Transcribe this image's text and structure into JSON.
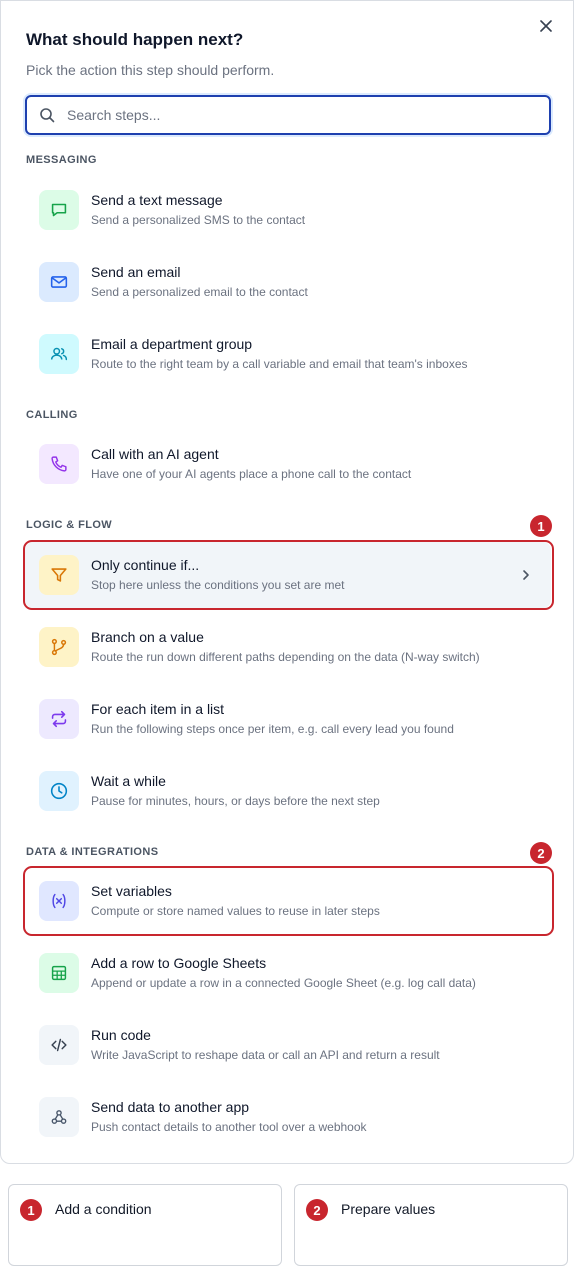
{
  "dialog": {
    "title": "What should happen next?",
    "subtitle": "Pick the action this step should perform.",
    "search_placeholder": "Search steps..."
  },
  "sections": [
    {
      "label": "MESSAGING",
      "items": [
        {
          "name": "Send a text message",
          "desc": "Send a personalized SMS to the contact",
          "icon": "message-icon",
          "color": "#16a34a",
          "bg": "#dcfce7"
        },
        {
          "name": "Send an email",
          "desc": "Send a personalized email to the contact",
          "icon": "mail-icon",
          "color": "#2563eb",
          "bg": "#dbeafe"
        },
        {
          "name": "Email a department group",
          "desc": "Route to the right team by a call variable and email that team's inboxes",
          "icon": "users-icon",
          "color": "#0891b2",
          "bg": "#cffafe"
        }
      ]
    },
    {
      "label": "CALLING",
      "items": [
        {
          "name": "Call with an AI agent",
          "desc": "Have one of your AI agents place a phone call to the contact",
          "icon": "phone-icon",
          "color": "#9333ea",
          "bg": "#f3e8ff"
        }
      ]
    },
    {
      "label": "LOGIC & FLOW",
      "items": [
        {
          "name": "Only continue if...",
          "desc": "Stop here unless the conditions you set are met",
          "icon": "filter-icon",
          "color": "#d97706",
          "bg": "#fef3c7"
        },
        {
          "name": "Branch on a value",
          "desc": "Route the run down different paths depending on the data (N-way switch)",
          "icon": "branch-icon",
          "color": "#d97706",
          "bg": "#fef3c7"
        },
        {
          "name": "For each item in a list",
          "desc": "Run the following steps once per item, e.g. call every lead you found",
          "icon": "repeat-icon",
          "color": "#7c3aed",
          "bg": "#ede9fe"
        },
        {
          "name": "Wait a while",
          "desc": "Pause for minutes, hours, or days before the next step",
          "icon": "clock-icon",
          "color": "#0284c7",
          "bg": "#e0f2fe"
        }
      ]
    },
    {
      "label": "DATA & INTEGRATIONS",
      "items": [
        {
          "name": "Set variables",
          "desc": "Compute or store named values to reuse in later steps",
          "icon": "variable-icon",
          "color": "#4f46e5",
          "bg": "#e0e7ff"
        },
        {
          "name": "Add a row to Google Sheets",
          "desc": "Append or update a row in a connected Google Sheet (e.g. log call data)",
          "icon": "sheet-icon",
          "color": "#16a34a",
          "bg": "#dcfce7"
        },
        {
          "name": "Run code",
          "desc": "Write JavaScript to reshape data or call an API and return a result",
          "icon": "code-icon",
          "color": "#374151",
          "bg": "#f1f5f9"
        },
        {
          "name": "Send data to another app",
          "desc": "Push contact details to another tool over a webhook",
          "icon": "webhook-icon",
          "color": "#475569",
          "bg": "#f1f5f9"
        }
      ]
    }
  ],
  "annotations": [
    {
      "number": "1",
      "label": "Add a condition"
    },
    {
      "number": "2",
      "label": "Prepare values"
    }
  ],
  "colors": {
    "accent": "#1e40af",
    "annotation": "#c8262e"
  }
}
